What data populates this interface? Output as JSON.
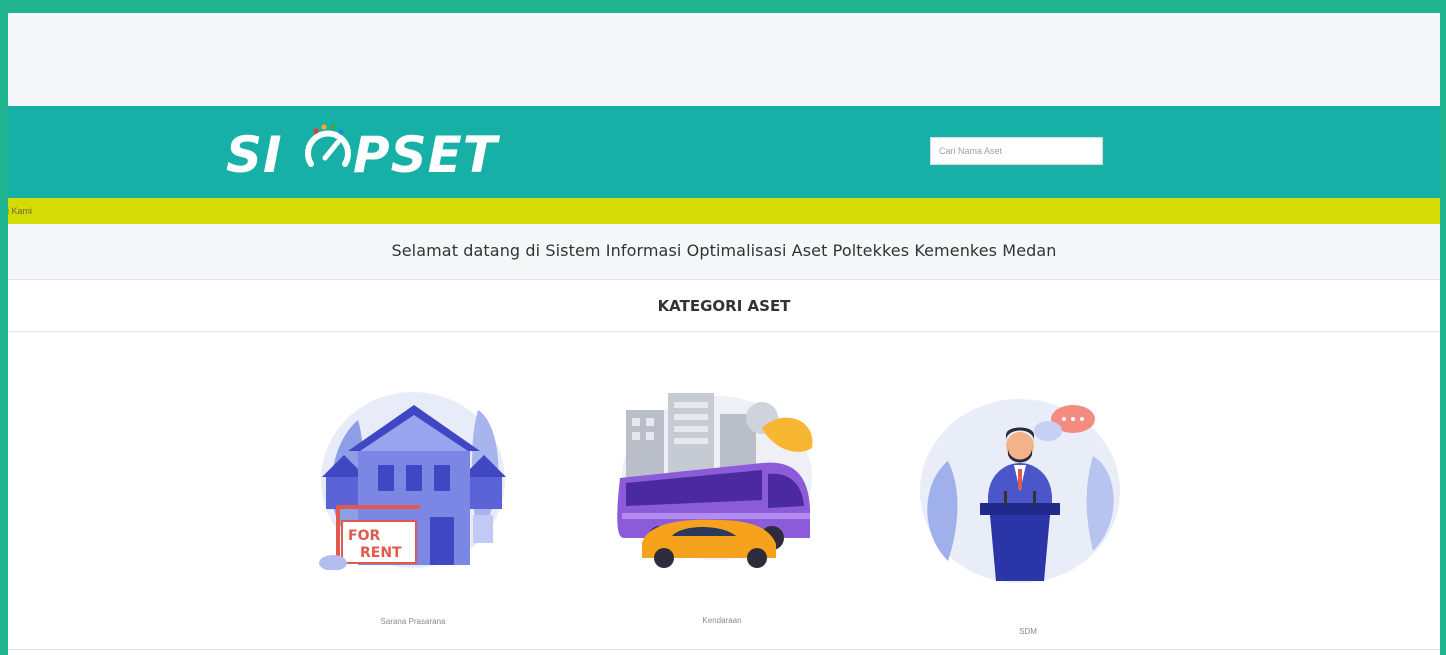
{
  "header": {
    "logo_text": "SIOPSET",
    "search_placeholder": "Cari Nama Aset"
  },
  "ticker": {
    "text": "gi Kami"
  },
  "welcome": {
    "text": "Selamat datang di Sistem Informasi Optimalisasi Aset Poltekkes Kemenkes Medan"
  },
  "categories": {
    "title": "KATEGORI ASET",
    "items": [
      {
        "label": "Sarana Prasarana",
        "icon": "house-for-rent-icon",
        "sign_line1": "FOR",
        "sign_line2": "RENT"
      },
      {
        "label": "Kendaraan",
        "icon": "vehicle-bus-car-icon"
      },
      {
        "label": "SDM",
        "icon": "speaker-podium-icon"
      }
    ]
  },
  "colors": {
    "frame": "#21b58f",
    "header": "#17b0a6",
    "ticker": "#d4dc05",
    "strip": "#f5f7f8"
  }
}
